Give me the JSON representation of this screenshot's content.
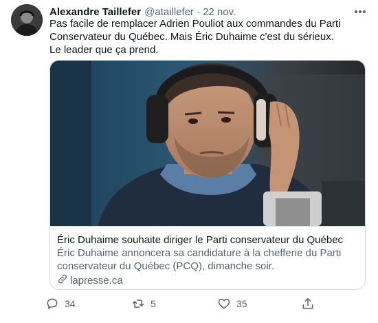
{
  "author": {
    "name": "Alexandre Taillefer",
    "handle": "@ataillefer",
    "separator": "·",
    "time": "22 nov."
  },
  "tweet": {
    "lines": [
      "Pas facile de remplacer Adrien Pouliot aux commandes du Parti",
      "Conservateur du Québec. Mais Éric Duhaime c'est du sérieux.",
      "Le leader que ça prend."
    ]
  },
  "card": {
    "title": "Éric Duhaime souhaite diriger le Parti conservateur du Québec",
    "description_lines": [
      "Éric Duhaime annoncera sa candidature à la chefferie du Parti",
      "conservateur du Québec (PCQ), dimanche soir."
    ],
    "domain": "lapresse.ca",
    "image_icon": "man-with-headphones-photo"
  },
  "actions": {
    "reply_count": "34",
    "retweet_count": "5",
    "like_count": "35"
  },
  "icons": {
    "more": "more-dots-icon",
    "reply": "reply-icon",
    "retweet": "retweet-icon",
    "like": "heart-icon",
    "share": "share-icon",
    "link": "link-icon"
  },
  "colors": {
    "text": "#0f1419",
    "secondary": "#536471",
    "border": "#cfd9de"
  }
}
